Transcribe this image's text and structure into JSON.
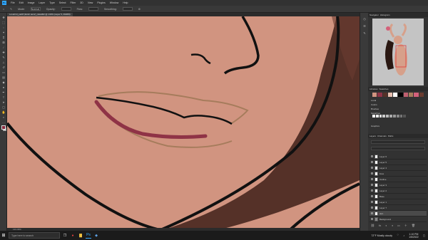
{
  "menu": [
    "File",
    "Edit",
    "Image",
    "Layer",
    "Type",
    "Select",
    "Filter",
    "3D",
    "View",
    "Plugins",
    "Window",
    "Help"
  ],
  "options": {
    "tool_label": "Mode:",
    "mode": "Normal",
    "opacity_label": "Opacity:",
    "flow_label": "Flow:",
    "smoothing_label": "Smoothing:"
  },
  "document_tab": "Lovebird_part8 (fetish asmr)_detail02 @ 133% (Layer 5, RGB/8)",
  "status": "133.33%",
  "panels": {
    "navigator_tabs": [
      "Navigator",
      "Histogram"
    ],
    "libraries": [
      "Libraries",
      "Swatches"
    ],
    "lib_items": [
      "Local",
      "Colors",
      "Brushes",
      "Swatches",
      "Graphics"
    ],
    "layer_tabs": [
      "Layers",
      "Channels",
      "Paths"
    ],
    "layers": [
      "Layer 6",
      "Layer 5",
      "Layer 4",
      "lines",
      "Outline",
      "Layer 3",
      "Layer 2",
      "Base",
      "Layer 1",
      "Layer 7",
      "Fill",
      "skin",
      "Background"
    ],
    "active_layer": "skin"
  },
  "taskbar": {
    "search_placeholder": "Type here to search",
    "weather": "72°F Mostly cloudy",
    "time": "1:10 PM",
    "date": "1/5/2022"
  },
  "colors": {
    "skin": "#d19480",
    "hair": "#553128",
    "lip": "#8f3346",
    "sketch": "#a67c5c",
    "accent": "#31a8ff"
  }
}
